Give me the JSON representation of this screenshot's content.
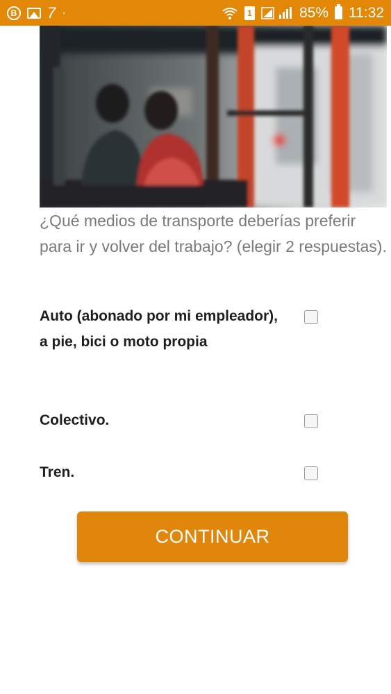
{
  "status_bar": {
    "left_glyph": "7",
    "dot": "·",
    "battery_percent": "85%",
    "time": "11:32",
    "sim_number": "1",
    "icons": [
      "b-icon",
      "image-icon",
      "wifi-icon",
      "sim-icon",
      "signal-icon",
      "battery-icon"
    ]
  },
  "hero_image": {
    "description": "bus interior photo",
    "accent_colors": [
      "#d24a2c",
      "#2a2a2a",
      "#e6e6e6"
    ]
  },
  "question": {
    "text": "¿Qué medios de transporte deberías preferir para ir y volver del trabajo? (elegir 2 respuestas)."
  },
  "options": [
    {
      "label": "Auto (abonado por mi empleador), a pie, bici o moto propia",
      "checked": false
    },
    {
      "label": "Colectivo.",
      "checked": false
    },
    {
      "label": "Tren.",
      "checked": false
    }
  ],
  "continue_button": {
    "label": "CONTINUAR"
  },
  "colors": {
    "accent": "#e38806",
    "button": "#e0860a",
    "question_text": "#7a7a7a",
    "option_text": "#1e1e1e"
  }
}
